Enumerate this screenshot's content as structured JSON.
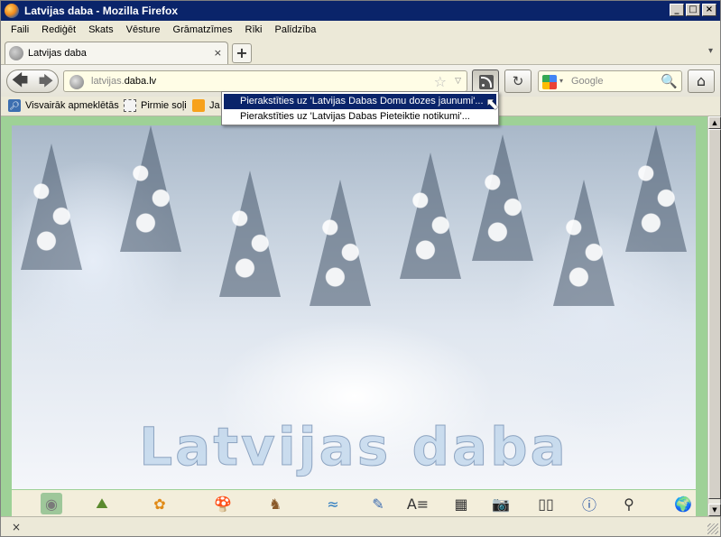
{
  "window": {
    "title": "Latvijas daba - Mozilla Firefox",
    "controls": [
      "_",
      "□",
      "×"
    ]
  },
  "menu": [
    "Faili",
    "Rediģēt",
    "Skats",
    "Vēsture",
    "Grāmatzīmes",
    "Rīki",
    "Palīdzība"
  ],
  "tabs": [
    {
      "label": "Latvijas daba",
      "close": "×"
    }
  ],
  "new_tab_label": "+",
  "tab_list_arrow": "▾",
  "nav": {
    "back": "🡄",
    "forward": "🡆",
    "url_prefix": "latvijas.",
    "url_domain": "daba.lv",
    "star": "☆",
    "url_dropdown": "▽",
    "reload": "↻",
    "home": "⌂"
  },
  "search": {
    "engine": "Google",
    "placeholder": "Google",
    "dropdown": "▾",
    "go": "🔍"
  },
  "bookmarks": [
    {
      "label": "Visvairāk apmeklētās",
      "icon": "most-visited-icon"
    },
    {
      "label": "Pirmie soļi",
      "icon": "page-icon"
    },
    {
      "label": "Ja",
      "icon": "rss-icon"
    }
  ],
  "rss_menu": {
    "items": [
      "Pierakstīties uz 'Latvijas Dabas Domu dozes jaunumi'...",
      "Pierakstīties uz 'Latvijas Dabas Pieteiktie notikumi'..."
    ],
    "selected_index": 0
  },
  "cursor": "⬉",
  "page": {
    "banner_text": "Latvijas daba",
    "icon_strip": [
      {
        "icon": "globe-icon",
        "glyph": "◉",
        "color": "#7a7a7a"
      },
      {
        "icon": "landscape-icon",
        "glyph": "⛰",
        "color": "#5a8a2e"
      },
      {
        "icon": "flower-icon",
        "glyph": "✿",
        "color": "#e08a16"
      },
      {
        "icon": "mushroom-icon",
        "glyph": "🍄",
        "color": "#8a4a1a"
      },
      {
        "icon": "deer-icon",
        "glyph": "♞",
        "color": "#8a5a2a"
      },
      {
        "icon": "water-icon",
        "glyph": "≈",
        "color": "#2a7ac0"
      },
      {
        "icon": "tools-icon",
        "glyph": "✎",
        "color": "#3a6ab0"
      },
      {
        "icon": "alphabet-icon",
        "glyph": "A≡",
        "color": "#333333"
      },
      {
        "icon": "table-icon",
        "glyph": "▦",
        "color": "#333333"
      },
      {
        "icon": "camera-icon",
        "glyph": "📷",
        "color": "#333333"
      },
      {
        "icon": "book-icon",
        "glyph": "▯▯",
        "color": "#333333"
      },
      {
        "icon": "info-icon",
        "glyph": "ⓘ",
        "color": "#1a4aa0"
      },
      {
        "icon": "magnifier-icon",
        "glyph": "⚲",
        "color": "#333333"
      },
      {
        "icon": "earth-icon",
        "glyph": "🌍",
        "color": "#2a7a30"
      }
    ],
    "active_icon_index": 0
  },
  "status": {
    "close": "×"
  },
  "colors": {
    "titlebar": "#0a246a",
    "menu_highlight": "#0a246a",
    "page_frame": "#9ed197",
    "icon_strip_bg": "#f3eedb"
  }
}
